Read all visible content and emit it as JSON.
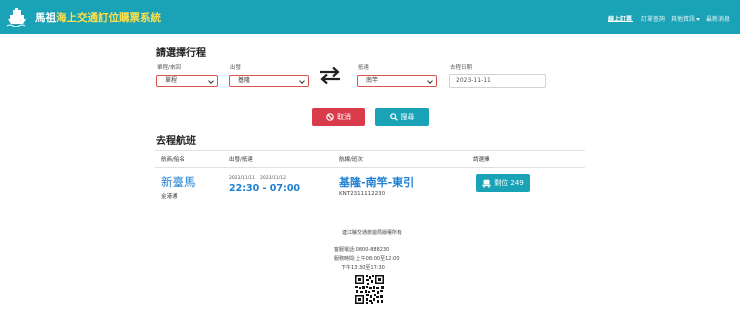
{
  "header": {
    "brand_prefix": "馬祖",
    "brand_suffix": "海上交通訂位購票系統",
    "nav": [
      {
        "label": "線上訂票"
      },
      {
        "label": "訂單查詢"
      },
      {
        "label": "其他資訊"
      },
      {
        "label": "最新消息"
      }
    ]
  },
  "form": {
    "title": "請選擇行程",
    "trip_type": {
      "label": "單程/來回",
      "value": "單程"
    },
    "departure": {
      "label": "出發",
      "value": "基隆"
    },
    "arrival": {
      "label": "抵達",
      "value": "南竿"
    },
    "date": {
      "label": "去程日期",
      "value": "2023-11-11"
    },
    "cancel_label": "取消",
    "search_label": "搜尋"
  },
  "results": {
    "title": "去程航班",
    "columns": [
      "航商/船名",
      "出發/抵達",
      "航線/班次",
      "請選擇"
    ],
    "rows": [
      {
        "ship": "新臺馬",
        "company": "金港通",
        "depart_date": "2023/11/11",
        "arrive_date": "2023/11/12",
        "times": "22:30 - 07:00",
        "route": "基隆-南竿-東引",
        "voyage": "KNT2311112230",
        "seats_label": "剩位 249"
      }
    ]
  },
  "footer": {
    "copyright": "連江縣交通旅遊局版權所有",
    "phone": "客服電話:0800-888230",
    "hours_am": "服務時間:上午08:00至12:00",
    "hours_pm": "下午13:30至17:30"
  },
  "colors": {
    "header_bg": "#1aa2b6",
    "brand_accent": "#ffe04a",
    "link_blue": "#1d7fd3",
    "cancel_red": "#d93b4b",
    "select_border": "#d9534f"
  },
  "icons": [
    "ship-icon",
    "swap-arrows-icon",
    "ban-icon",
    "search-icon",
    "seat-icon",
    "qr-code"
  ]
}
